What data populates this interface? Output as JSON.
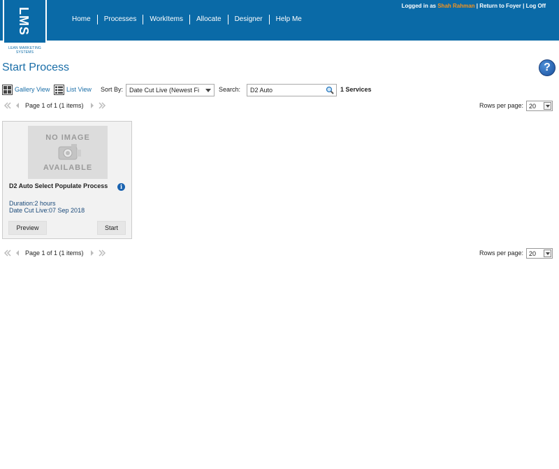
{
  "header": {
    "logo_text": "LMS",
    "logo_sub": "LEAN MARKETING SYSTEMS",
    "nav": [
      "Home",
      "Processes",
      "WorkItems",
      "Allocate",
      "Designer",
      "Help Me"
    ],
    "logged_in_prefix": "Logged in as",
    "user_name": "Shah Rahman",
    "return_link": "Return to Foyer",
    "logout_link": "Log Off",
    "separator": "|"
  },
  "page": {
    "title": "Start Process",
    "help": "?"
  },
  "toolbar": {
    "gallery_view": "Gallery View",
    "list_view": "List View",
    "sort_label": "Sort By:",
    "sort_value": "Date Cut Live (Newest Fi",
    "search_label": "Search:",
    "search_value": "D2 Auto",
    "services_count": "1 Services"
  },
  "pager": {
    "page_text": "Page 1 of 1 (1 items)",
    "rows_label": "Rows per page:",
    "rows_value": "20"
  },
  "card": {
    "no_image_top": "NO IMAGE",
    "no_image_bottom": "AVAILABLE",
    "title": "D2 Auto Select Populate Process",
    "duration": "Duration:2 hours",
    "date_cut_live": "Date Cut Live:07 Sep 2018",
    "info": "i",
    "preview_label": "Preview",
    "start_label": "Start"
  },
  "colors": {
    "header_bg": "#0a6aa7",
    "title": "#1a6ea8",
    "user_name": "#f7941d"
  }
}
